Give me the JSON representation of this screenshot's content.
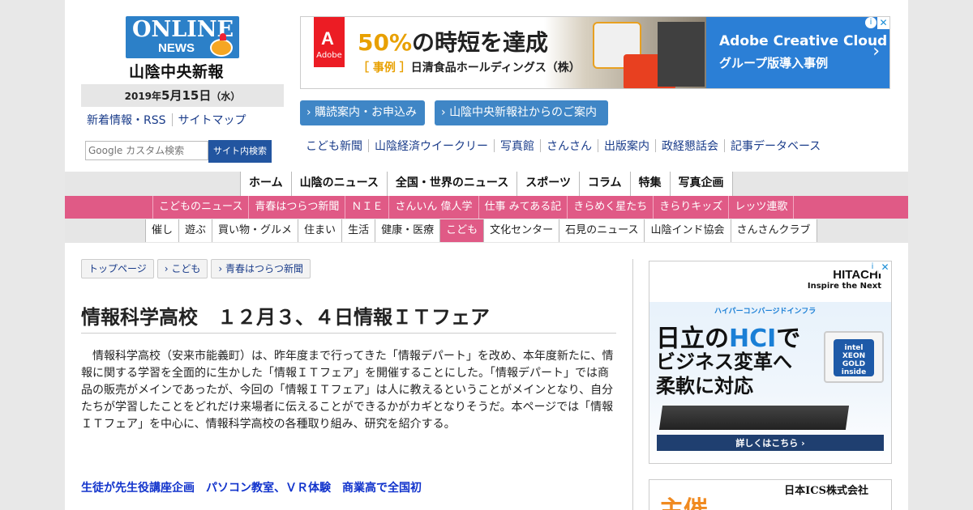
{
  "header": {
    "logo_online": "ONLINE",
    "logo_news": "NEWS",
    "paper_name": "山陰中央新報",
    "date_year": "2019年",
    "date_md": "5月15日",
    "date_dow": "（水）",
    "links": [
      "新着情報・RSS",
      "サイトマップ"
    ],
    "search_placeholder": "Google カスタム検索",
    "search_button": "サイト内検索"
  },
  "top_ad": {
    "brand_glyph": "A",
    "brand_label": "Adobe",
    "headline_hl": "50%",
    "headline_rest": "の時短を達成",
    "sub_bracket": "［ 事例 ］",
    "sub_text": "日清食品ホールディングス（株）",
    "right_line1": "Adobe Creative Cloud",
    "right_line2": "グループ版導入事例",
    "info": "i",
    "close": "✕"
  },
  "blue_buttons": [
    "購読案内・お申込み",
    "山陰中央新報社からのご案内"
  ],
  "sub_links": [
    "こども新聞",
    "山陰経済ウイークリー",
    "写真館",
    "さんさん",
    "出版案内",
    "政経懇話会",
    "記事データベース"
  ],
  "nav_main": [
    "ホーム",
    "山陰のニュース",
    "全国・世界のニュース",
    "スポーツ",
    "コラム",
    "特集",
    "写真企画"
  ],
  "nav_kids": [
    "こどものニュース",
    "青春はつらつ新聞",
    "ＮＩＥ",
    "さんいん 偉人学",
    "仕事 みてある記",
    "きらめく星たち",
    "きらりキッズ",
    "レッツ連歌"
  ],
  "nav_life": [
    "催し",
    "遊ぶ",
    "買い物・グルメ",
    "住まい",
    "生活",
    "健康・医療",
    "こども",
    "文化センター",
    "石見のニュース",
    "山陰インド協会",
    "さんさんクラブ"
  ],
  "nav_life_active": "こども",
  "breadcrumb": [
    "トップページ",
    "こども",
    "青春はつらつ新聞"
  ],
  "article": {
    "title": "情報科学高校　１２月３、４日情報ＩＴフェア",
    "body": "情報科学高校（安来市能義町）は、昨年度まで行ってきた「情報デパート」を改め、本年度新たに、情報に関する学習を全面的に生かした「情報ＩＴフェア」を開催することにした。「情報デパート」では商品の販売がメインであったが、今回の「情報ＩＴフェア」は人に教えるということがメインとなり、自分たちが学習したことをどれだけ来場者に伝えることができるかがカギとなりそうだ。本ページでは「情報ＩＴフェア」を中心に、情報科学高校の各種取り組み、研究を紹介する。",
    "subhead": "生徒が先生役講座企画　パソコン教室、ＶＲ体験　商業高で全国初"
  },
  "side_ad": {
    "brand": "HITACHI",
    "tagline": "Inspire the Next",
    "small": "ハイパーコンバージドインフラ",
    "l1_pre": "日立の",
    "l1_hl": "HCI",
    "l1_post": "で",
    "l2": "ビジネス変革へ",
    "l3": "柔軟に対応",
    "chip": "intel XEON GOLD inside",
    "more": "詳しくはこちら ›",
    "info": "i",
    "close": "✕"
  },
  "side_ad2": {
    "company": "日本ICS株式会社",
    "big": "主催"
  }
}
